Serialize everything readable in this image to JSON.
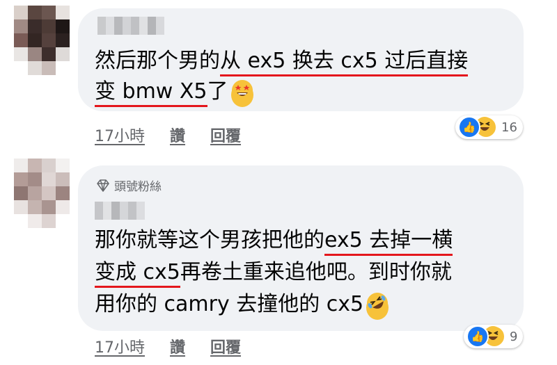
{
  "comments": [
    {
      "lines": [
        [
          {
            "t": "然后那个男的"
          },
          {
            "t": "从 ex5 换去 cx5 过后直接",
            "u": true
          }
        ],
        [
          {
            "t": "变 bmw X5",
            "u": true
          },
          {
            "t": "了"
          }
        ]
      ],
      "emoji": "star-struck-emoji",
      "time": "17小時",
      "like": "讚",
      "reply": "回覆",
      "reactions": 16
    },
    {
      "badge": "頭號粉絲",
      "lines": [
        [
          {
            "t": "那你就等这个男孩把他的"
          },
          {
            "t": "ex5 去掉一横",
            "u": true
          }
        ],
        [
          {
            "t": "变成 cx5",
            "u": true
          },
          {
            "t": "再卷土重来追他吧。到时你就"
          }
        ],
        [
          {
            "t": "用你的 camry 去撞他的 cx5"
          }
        ]
      ],
      "emoji": "rolling-laughing-emoji",
      "time": "17小時",
      "like": "讚",
      "reply": "回覆",
      "reactions": 9
    }
  ],
  "colors": {
    "bubble": "#f0f2f5",
    "underline": "#e4161c",
    "like": "#1877f2",
    "meta": "#65676b"
  }
}
